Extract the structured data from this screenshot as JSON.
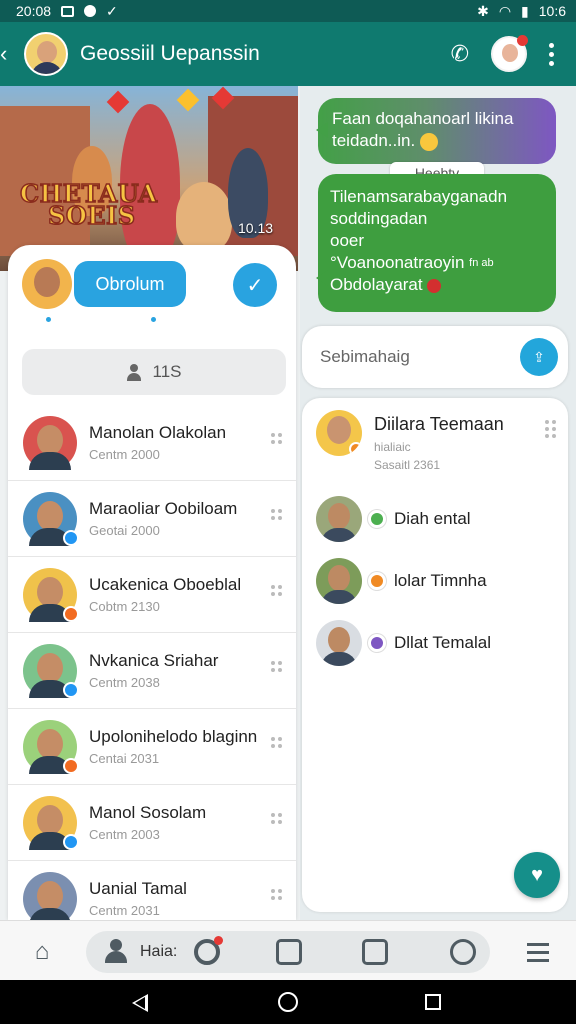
{
  "status_bar": {
    "time": "20:08",
    "right_time": "10:6"
  },
  "app_bar": {
    "title": "Geossiil Uepanssin"
  },
  "hero": {
    "title_line1": "CHETAUA",
    "title_line2": "SOEIS",
    "timestamp": "10.13"
  },
  "profile_row": {
    "button_label": "Obrolum"
  },
  "count_bar": {
    "count": "11S"
  },
  "contacts": [
    {
      "name": "Manolan Olakolan",
      "sub": "Centm 2000",
      "avatar_bg": "#d9534f",
      "badge": ""
    },
    {
      "name": "Maraoliar Oobiloam",
      "sub": "Geotai 2000",
      "avatar_bg": "#4a90c2",
      "badge": "#2196f3"
    },
    {
      "name": "Ucakenica Oboeblal",
      "sub": "Cobtm 2130",
      "avatar_bg": "#f0c24b",
      "badge": "#f26b21"
    },
    {
      "name": "Nvkanica Sriahar",
      "sub": "Centm 2038",
      "avatar_bg": "#7cc38c",
      "badge": "#2196f3"
    },
    {
      "name": "Upolonihelodo blaginn",
      "sub": "Centai 2031",
      "avatar_bg": "#9bd17b",
      "badge": "#f26b21"
    },
    {
      "name": "Manol Sosolam",
      "sub": "Centm 2003",
      "avatar_bg": "#f2c14e",
      "badge": "#2196f3"
    },
    {
      "name": "Uanial Tamal",
      "sub": "Centm 2031",
      "avatar_bg": "#7b8fb0",
      "badge": ""
    }
  ],
  "messages": {
    "bubble1_line1": "Faan doqahanoarl likina",
    "bubble1_line2": "teidadn..in.",
    "hint": "Heebtv",
    "bubble2_line1": "Tilenamsarabayganadn",
    "bubble2_line2": "soddingadan",
    "bubble2_line3": "ooer",
    "bubble2_line4": "°Voanoonatraoyin",
    "bubble2_sup": "fn ab",
    "bubble2_line5": "Obdolayarat"
  },
  "search": {
    "placeholder": "Sebimahaig"
  },
  "friends_card": {
    "title": "Diilara Teemaan",
    "sub1": "hialiaic",
    "sub2": "Sasaitl 2361",
    "friends": [
      {
        "name": "Diah ental",
        "status_color": "#4caf50",
        "avatar_bg": "#9aa77a"
      },
      {
        "name": "lolar Timnha",
        "status_color": "#f08a24",
        "avatar_bg": "#7d9c5a"
      },
      {
        "name": "Dllat Temalal",
        "status_color": "#7e57c2",
        "avatar_bg": "#d9dde2"
      }
    ]
  },
  "bottom_nav": {
    "label": "Haia:"
  },
  "colors": {
    "teal": "#0f7a6f",
    "blue": "#29a3e0",
    "green": "#3e9e3f",
    "purple": "#7e57c2"
  }
}
